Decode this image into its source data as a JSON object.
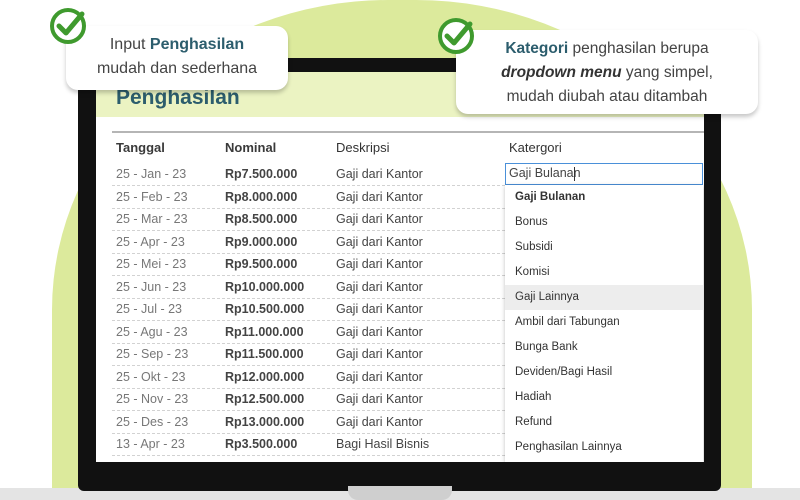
{
  "colors": {
    "accent_green": "#dcea9c",
    "title_teal": "#2c5d6d",
    "check_green": "#3f9a2e"
  },
  "callouts": {
    "left": {
      "l1_prefix": "Input ",
      "l1_bold": "Penghasilan",
      "l2": "mudah dan sederhana",
      "icon": "check-circle-icon"
    },
    "right": {
      "l1_bold": "Kategori",
      "l1_rest": " penghasilan berupa",
      "l2_bold": "dropdown menu",
      "l2_rest": " yang simpel,",
      "l3": "mudah diubah atau ditambah",
      "icon": "check-circle-icon"
    }
  },
  "page": {
    "title": "Penghasilan"
  },
  "table": {
    "headers": {
      "date": "Tanggal",
      "nominal": "Nominal",
      "desc": "Deskripsi",
      "category": "Katergori"
    },
    "rows": [
      {
        "date": "25 - Jan - 23",
        "nominal": "Rp7.500.000",
        "desc": "Gaji dari Kantor"
      },
      {
        "date": "25 - Feb - 23",
        "nominal": "Rp8.000.000",
        "desc": "Gaji dari Kantor"
      },
      {
        "date": "25 - Mar - 23",
        "nominal": "Rp8.500.000",
        "desc": "Gaji dari Kantor"
      },
      {
        "date": "25 - Apr - 23",
        "nominal": "Rp9.000.000",
        "desc": "Gaji dari Kantor"
      },
      {
        "date": "25 - Mei - 23",
        "nominal": "Rp9.500.000",
        "desc": "Gaji dari Kantor"
      },
      {
        "date": "25 - Jun - 23",
        "nominal": "Rp10.000.000",
        "desc": "Gaji dari Kantor"
      },
      {
        "date": "25 - Jul - 23",
        "nominal": "Rp10.500.000",
        "desc": "Gaji dari Kantor"
      },
      {
        "date": "25 - Agu - 23",
        "nominal": "Rp11.000.000",
        "desc": "Gaji dari Kantor"
      },
      {
        "date": "25 - Sep - 23",
        "nominal": "Rp11.500.000",
        "desc": "Gaji dari Kantor"
      },
      {
        "date": "25 - Okt - 23",
        "nominal": "Rp12.000.000",
        "desc": "Gaji dari Kantor"
      },
      {
        "date": "25 - Nov - 23",
        "nominal": "Rp12.500.000",
        "desc": "Gaji dari Kantor"
      },
      {
        "date": "25 - Des - 23",
        "nominal": "Rp13.000.000",
        "desc": "Gaji dari Kantor"
      },
      {
        "date": "13 - Apr - 23",
        "nominal": "Rp3.500.000",
        "desc": "Bagi Hasil Bisnis"
      }
    ]
  },
  "category_select": {
    "value": "Gaji Bulanan",
    "options": [
      "Gaji Bulanan",
      "Bonus",
      "Subsidi",
      "Komisi",
      "Gaji Lainnya",
      "Ambil dari Tabungan",
      "Bunga Bank",
      "Deviden/Bagi Hasil",
      "Hadiah",
      "Refund",
      "Penghasilan Lainnya"
    ],
    "selected_index": 0,
    "hover_index": 4
  }
}
